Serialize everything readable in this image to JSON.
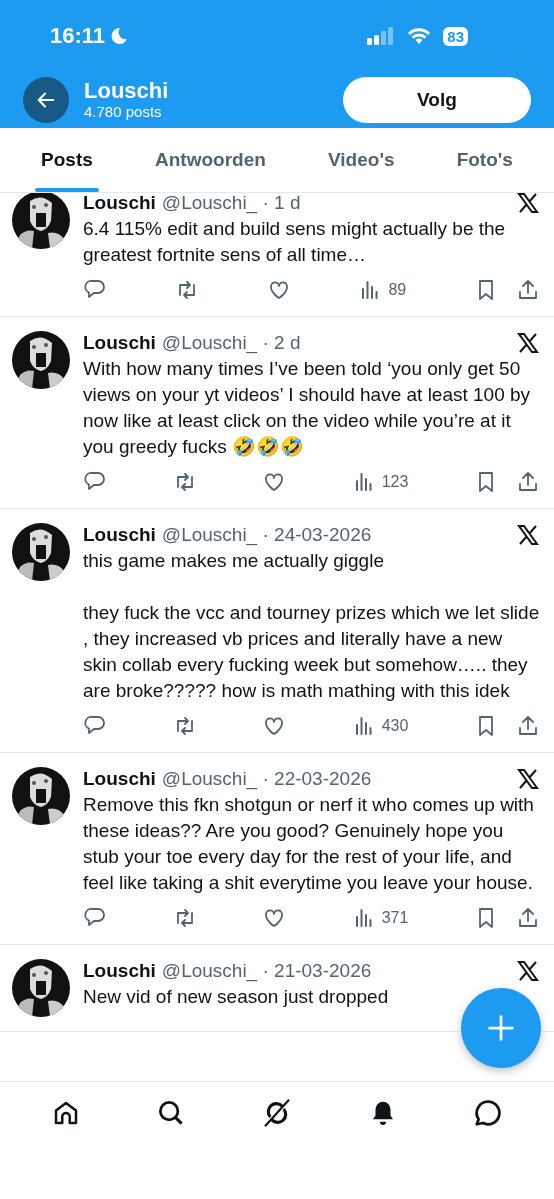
{
  "status_bar": {
    "time": "16:11",
    "battery": "83"
  },
  "header": {
    "name": "Louschi",
    "post_count": "4.780 posts",
    "follow_button": "Volg"
  },
  "tabs": [
    {
      "label": "Posts",
      "selected": true
    },
    {
      "label": "Antwoorden",
      "selected": false
    },
    {
      "label": "Video's",
      "selected": false
    },
    {
      "label": "Foto's",
      "selected": false
    }
  ],
  "tweets": [
    {
      "name": "Louschi",
      "meta": "@Louschi_ · 1 d",
      "text": "6.4 115% edit and build sens might actually be the greatest fortnite sens of all time…",
      "views": "89"
    },
    {
      "name": "Louschi",
      "meta": "@Louschi_ · 2 d",
      "text": "With how many times I’ve been told ‘you only get 50 views on your yt videos’ I should have at least 100 by now like at least click on the video while you’re at it you greedy fucks 🤣🤣🤣",
      "views": "123"
    },
    {
      "name": "Louschi",
      "meta": "@Louschi_ · 24-03-2026",
      "text": "this game makes me actually giggle\n\nthey fuck the vcc and tourney prizes which we let slide , they increased vb prices and literally have a new skin collab every fucking week but somehow….. they are broke????? how is math mathing with this idek",
      "views": "430"
    },
    {
      "name": "Louschi",
      "meta": "@Louschi_ · 22-03-2026",
      "text": "Remove this fkn shotgun or nerf it who comes up with these ideas?? Are you good? Genuinely hope you stub your toe every day for the rest of your life, and feel like taking a shit everytime you leave your house.",
      "views": "371"
    },
    {
      "name": "Louschi",
      "meta": "@Louschi_ · 21-03-2026",
      "text": "New vid of new season just dropped"
    }
  ]
}
